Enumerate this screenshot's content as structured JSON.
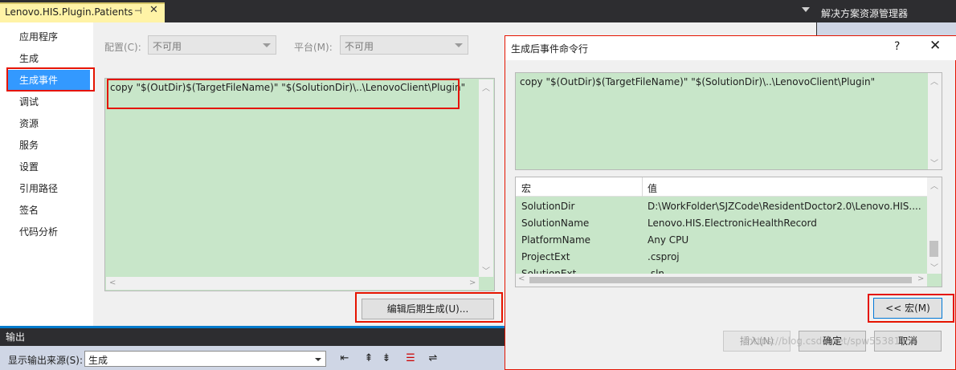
{
  "document_tab": {
    "title": "Lenovo.HIS.Plugin.Patients",
    "pin_icon": "pin-icon",
    "close_icon": "close-icon"
  },
  "side_nav": {
    "items": [
      {
        "label": "应用程序"
      },
      {
        "label": "生成"
      },
      {
        "label": "生成事件",
        "active": true
      },
      {
        "label": "调试"
      },
      {
        "label": "资源"
      },
      {
        "label": "服务"
      },
      {
        "label": "设置"
      },
      {
        "label": "引用路径"
      },
      {
        "label": "签名"
      },
      {
        "label": "代码分析"
      }
    ]
  },
  "config_bar": {
    "config_label": "配置(C):",
    "config_value": "不可用",
    "platform_label": "平台(M):",
    "platform_value": "不可用"
  },
  "post_build": {
    "command": "copy \"$(OutDir)$(TargetFileName)\" \"$(SolutionDir)\\..\\LenovoClient\\Plugin\"",
    "edit_button": "编辑后期生成(U)..."
  },
  "solution_explorer": {
    "title": "解决方案资源管理器"
  },
  "output_panel": {
    "title": "输出",
    "source_label": "显示输出来源(S):",
    "source_value": "生成"
  },
  "dialog": {
    "title": "生成后事件命令行",
    "help": "?",
    "close": "✕",
    "command": "copy \"$(OutDir)$(TargetFileName)\" \"$(SolutionDir)\\..\\LenovoClient\\Plugin\"",
    "table": {
      "headers": [
        "宏",
        "值"
      ],
      "rows": [
        {
          "name": "SolutionDir",
          "value": "D:\\WorkFolder\\SJZCode\\ResidentDoctor2.0\\Lenovo.HIS...."
        },
        {
          "name": "SolutionName",
          "value": "Lenovo.HIS.ElectronicHealthRecord"
        },
        {
          "name": "PlatformName",
          "value": "Any CPU"
        },
        {
          "name": "ProjectExt",
          "value": ".csproj"
        },
        {
          "name": "SolutionExt",
          "value": ".sln"
        }
      ]
    },
    "macros_button": "<< 宏(M)",
    "insert_button": "插入(N)",
    "ok_button": "确定",
    "cancel_button": "取消"
  },
  "watermark": "https://blog.csdn.net/spw55381155",
  "colors": {
    "highlight": "#e51400",
    "selection": "#3399ff",
    "editor_green": "#c8e6c9",
    "tab_yellow": "#fff3a6"
  }
}
